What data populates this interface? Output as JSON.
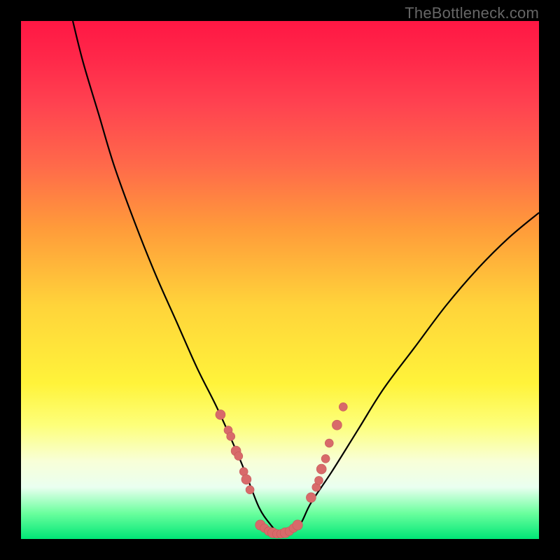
{
  "watermark": "TheBottleneck.com",
  "chart_data": {
    "type": "line",
    "title": "",
    "xlabel": "",
    "ylabel": "",
    "xlim": [
      0,
      100
    ],
    "ylim": [
      0,
      100
    ],
    "grid": false,
    "legend_position": "none",
    "curve_points": {
      "x": [
        10,
        12,
        15,
        18,
        22,
        26,
        30,
        34,
        38,
        42,
        44,
        46,
        48,
        50,
        52,
        54,
        56,
        60,
        65,
        70,
        76,
        82,
        88,
        94,
        100
      ],
      "y": [
        100,
        92,
        82,
        72,
        61,
        51,
        42,
        33,
        25,
        16,
        11,
        6,
        3,
        1,
        1,
        3,
        7,
        13,
        21,
        29,
        37,
        45,
        52,
        58,
        63
      ]
    },
    "markers_left": {
      "x": [
        38.5,
        40.0,
        40.5,
        41.5,
        42.0,
        43.0,
        43.5,
        44.2
      ],
      "y": [
        24.0,
        21.0,
        19.8,
        17.0,
        16.0,
        13.0,
        11.5,
        9.5
      ]
    },
    "markers_right": {
      "x": [
        56.0,
        57.0,
        57.5,
        58.0,
        58.8,
        59.5,
        61.0,
        62.2
      ],
      "y": [
        8.0,
        10.0,
        11.3,
        13.5,
        15.5,
        18.5,
        22.0,
        25.5
      ]
    },
    "markers_bottom": {
      "x": [
        46.2,
        47.0,
        47.8,
        48.6,
        49.4,
        50.2,
        51.0,
        51.8,
        52.6,
        53.4
      ],
      "y": [
        2.7,
        2.1,
        1.5,
        1.2,
        1.0,
        1.0,
        1.2,
        1.5,
        2.1,
        2.7
      ]
    },
    "colors": {
      "curve": "#000000",
      "marker_fill": "#d86a6a",
      "marker_stroke": "#c45a5a"
    }
  }
}
